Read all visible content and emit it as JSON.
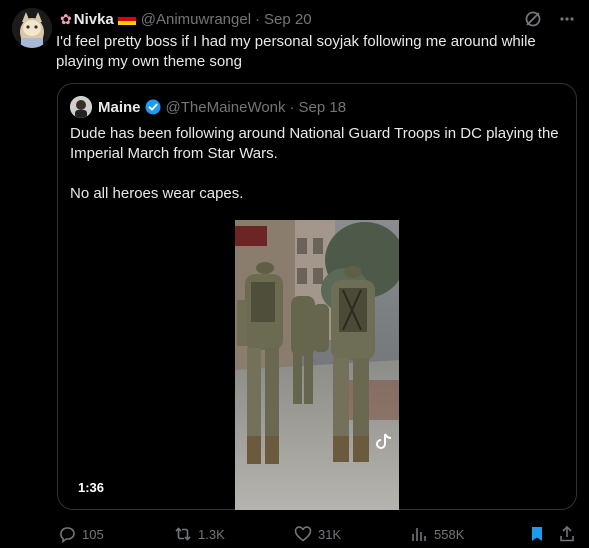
{
  "tweet": {
    "display_name": "Nivka",
    "handle": "@Animuwrangel",
    "separator": "·",
    "date": "Sep 20",
    "text": "I'd feel pretty boss if I had my personal soyjak following me around while playing my own theme song"
  },
  "quote": {
    "display_name": "Maine",
    "handle": "@TheMaineWonk",
    "separator": "·",
    "date": "Sep 18",
    "text_line1": "Dude has been following around National Guard Troops in DC playing the Imperial March from Star Wars.",
    "text_line2": "No all heroes wear capes.",
    "video_duration": "1:36"
  },
  "actions": {
    "replies": "105",
    "reposts": "1.3K",
    "likes": "31K",
    "views": "558K"
  },
  "colors": {
    "background": "#000000",
    "text": "#e7e9ea",
    "muted": "#71767b",
    "accent": "#1d9bf0",
    "border": "#2f3336"
  },
  "icons": [
    "grok-icon",
    "more-icon",
    "reply-icon",
    "repost-icon",
    "like-icon",
    "views-icon",
    "bookmark-icon",
    "share-icon",
    "verified-badge-icon"
  ]
}
